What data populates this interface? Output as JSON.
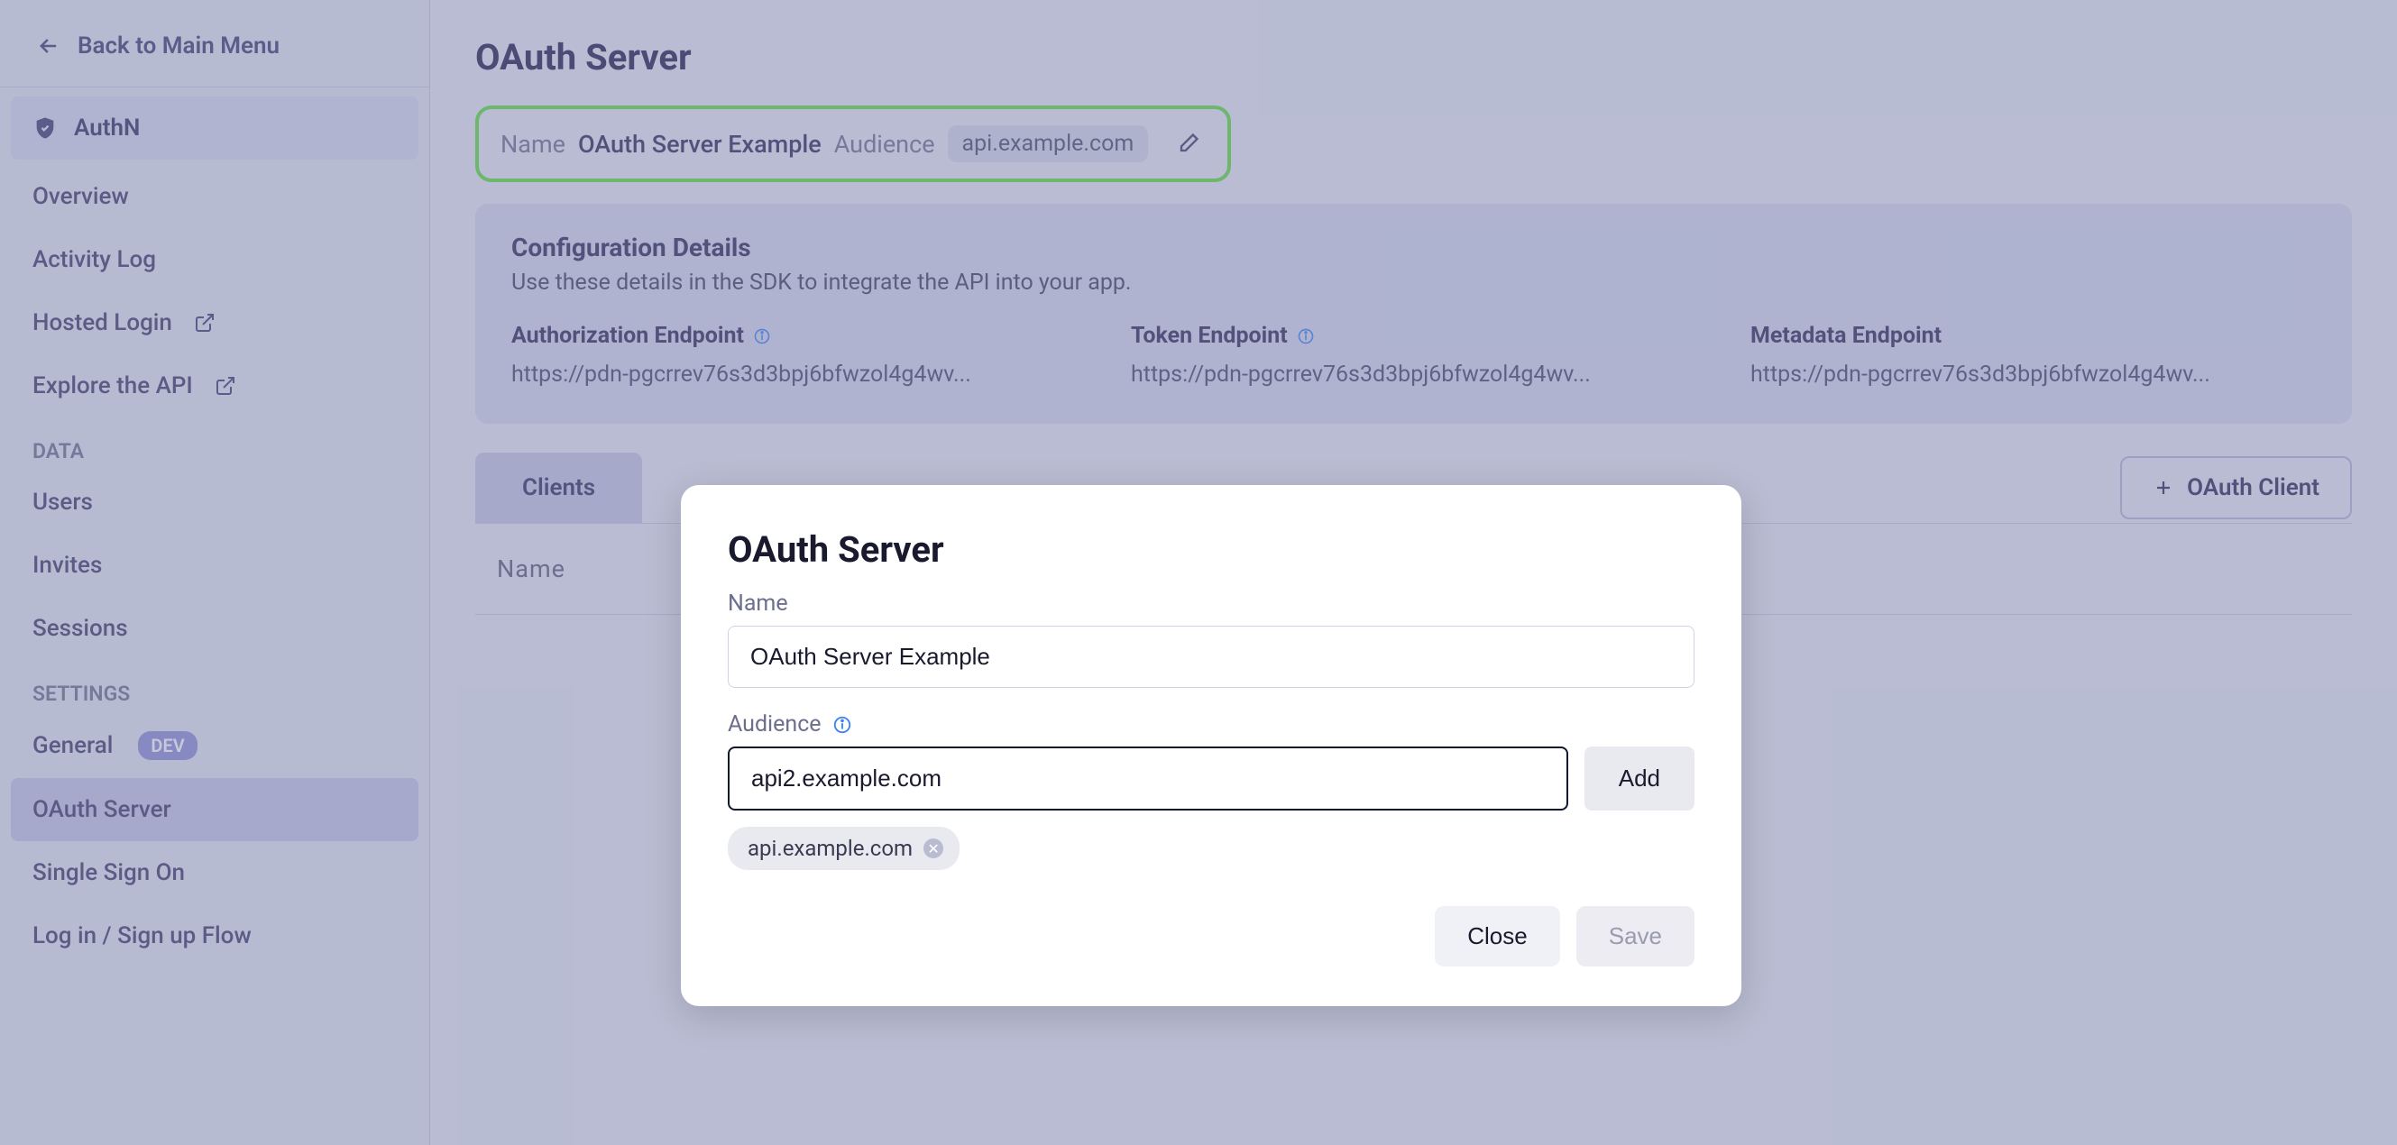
{
  "back_label": "Back to Main Menu",
  "sidebar": {
    "authn": "AuthN",
    "overview": "Overview",
    "activity_log": "Activity Log",
    "hosted_login": "Hosted Login",
    "explore_api": "Explore the API",
    "section_data": "DATA",
    "users": "Users",
    "invites": "Invites",
    "sessions": "Sessions",
    "section_settings": "SETTINGS",
    "general": "General",
    "dev_badge": "DEV",
    "oauth_server": "OAuth Server",
    "sso": "Single Sign On",
    "login_flow": "Log in / Sign up Flow"
  },
  "page": {
    "title": "OAuth Server",
    "name_label": "Name",
    "name_value": "OAuth Server Example",
    "audience_label": "Audience",
    "audience_chip": "api.example.com"
  },
  "config": {
    "title": "Configuration Details",
    "subtitle": "Use these details in the SDK to integrate the API into your app.",
    "auth_label": "Authorization Endpoint",
    "auth_url": "https://pdn-pgcrrev76s3d3bpj6bfwzol4g4wv...",
    "token_label": "Token Endpoint",
    "token_url": "https://pdn-pgcrrev76s3d3bpj6bfwzol4g4wv...",
    "meta_label": "Metadata Endpoint",
    "meta_url": "https://pdn-pgcrrev76s3d3bpj6bfwzol4g4wv..."
  },
  "tabs": {
    "clients": "Clients",
    "new_client": "OAuth Client"
  },
  "table": {
    "col_name": "Name"
  },
  "modal": {
    "title": "OAuth Server",
    "name_label": "Name",
    "name_value": "OAuth Server Example",
    "audience_label": "Audience",
    "audience_input": "api2.example.com",
    "add": "Add",
    "tag": "api.example.com",
    "close": "Close",
    "save": "Save"
  }
}
